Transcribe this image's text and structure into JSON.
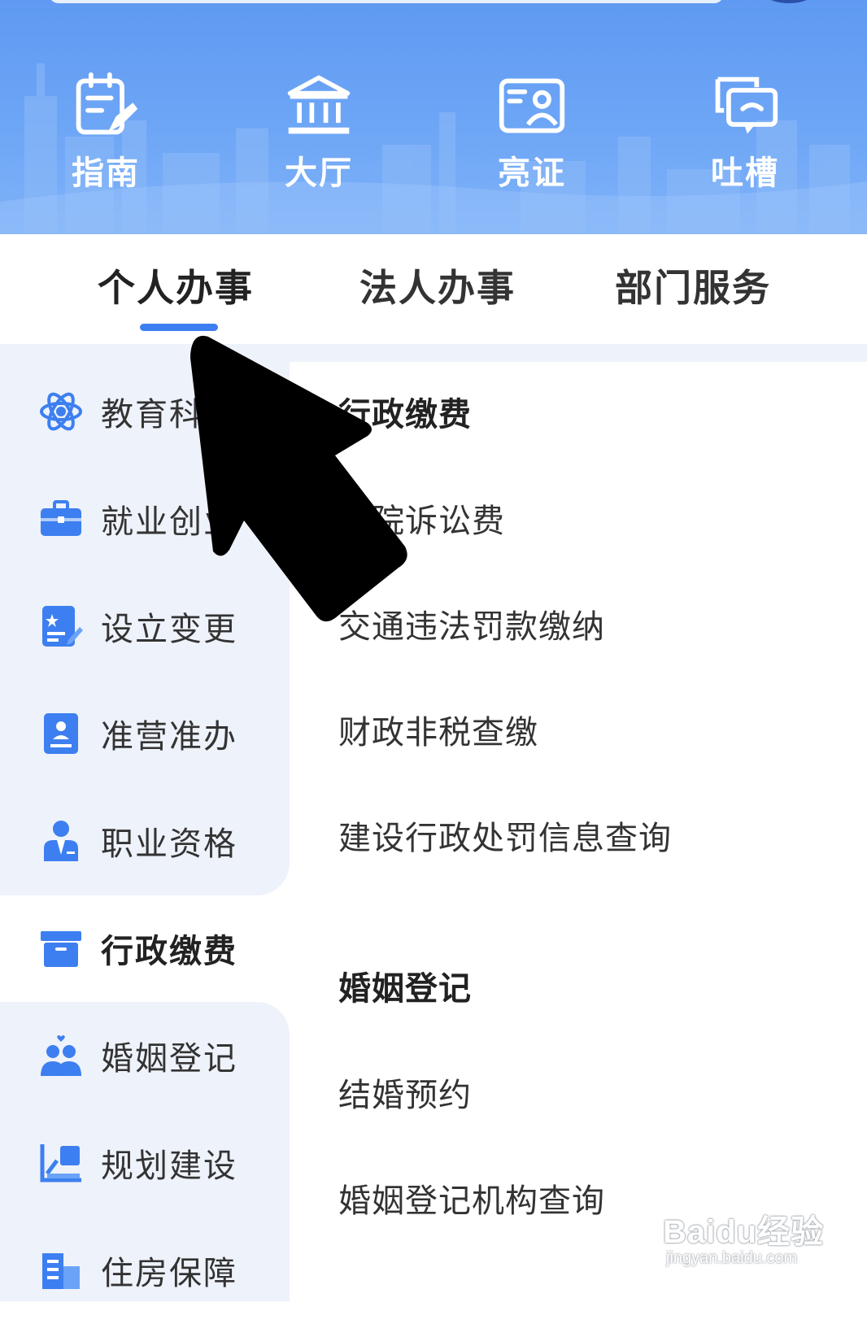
{
  "quick_actions": [
    {
      "label": "指南",
      "icon": "guide-icon"
    },
    {
      "label": "大厅",
      "icon": "hall-icon"
    },
    {
      "label": "亮证",
      "icon": "id-card-icon"
    },
    {
      "label": "吐槽",
      "icon": "feedback-icon"
    }
  ],
  "tabs": [
    {
      "label": "个人办事",
      "active": true
    },
    {
      "label": "法人办事",
      "active": false
    },
    {
      "label": "部门服务",
      "active": false
    }
  ],
  "sidebar": {
    "items": [
      {
        "label": "教育科研",
        "icon": "atom-icon"
      },
      {
        "label": "就业创业",
        "icon": "briefcase-icon"
      },
      {
        "label": "设立变更",
        "icon": "certificate-edit-icon"
      },
      {
        "label": "准营准办",
        "icon": "license-icon"
      },
      {
        "label": "职业资格",
        "icon": "professional-icon"
      },
      {
        "label": "行政缴费",
        "icon": "box-icon",
        "active": true
      },
      {
        "label": "婚姻登记",
        "icon": "couple-icon"
      },
      {
        "label": "规划建设",
        "icon": "planning-icon"
      },
      {
        "label": "住房保障",
        "icon": "housing-icon"
      }
    ]
  },
  "content": {
    "sections": [
      {
        "heading": "行政缴费",
        "items": [
          "法院诉讼费",
          "交通违法罚款缴纳",
          "财政非税查缴",
          "建设行政处罚信息查询"
        ]
      },
      {
        "heading": "婚姻登记",
        "items": [
          "结婚预约",
          "婚姻登记机构查询"
        ]
      }
    ]
  },
  "watermark": {
    "brand": "Baidu经验",
    "sub": "jingyan.baidu.com"
  },
  "colors": {
    "banner": "#6ea6f6",
    "accent": "#3d7ff0",
    "sidebar_bg": "#eef2fa",
    "text": "#333333"
  }
}
